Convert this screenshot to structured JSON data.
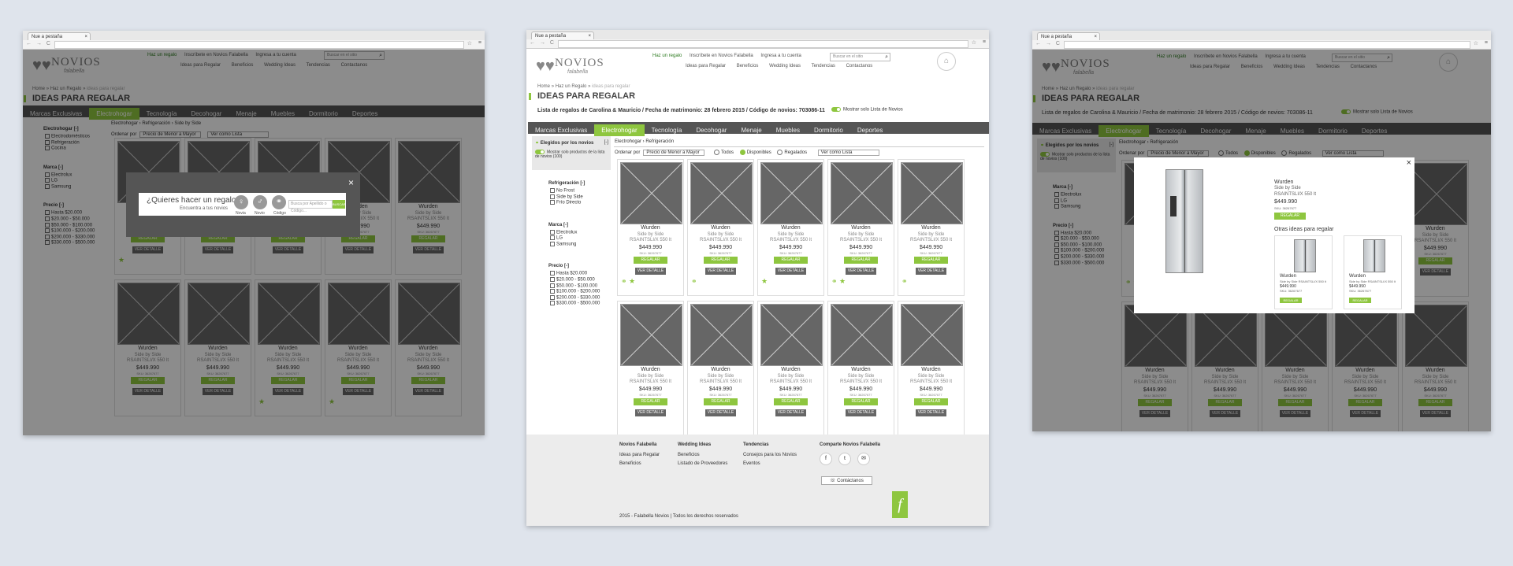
{
  "browser": {
    "tab_title": "Nue a pestaña",
    "tab_close": "×",
    "nav": "← → C",
    "url": "",
    "star": "☆",
    "menu": "≡"
  },
  "header": {
    "logo_name": "NOVIOS",
    "logo_sub": "falabella",
    "top_links": [
      "Haz un regalo",
      "Inscríbete en Novios Falabella",
      "Ingresa a tu cuenta"
    ],
    "search_placeholder": "Buscar en el sitio",
    "sub_links": [
      "Ideas para Regalar",
      "Beneficios",
      "Wedding Ideas",
      "Tendencias",
      "Contactanos"
    ]
  },
  "breadcrumb": {
    "home": "Home",
    "sep": "»",
    "mid": "Haz un Regalo",
    "last": "ideas para regalar"
  },
  "page_title": "IDEAS PARA REGALAR",
  "list_info": "Lista de regalos de Carolina & Mauricio / Fecha de matrimonio: 28 febrero 2015 / Código de novios: 703086-11",
  "toggle_label": "Mostrar solo Lista de Novios",
  "categories": [
    "Marcas Exclusivas",
    "Electrohogar",
    "Tecnología",
    "Decohogar",
    "Menaje",
    "Muebles",
    "Dormitorio",
    "Deportes"
  ],
  "category_crumb": "Electrohogar › Refrigeración",
  "category_crumb_w1": "Electrohogar › Refrigeración › Side by Side",
  "sort": {
    "label": "Ordenar por",
    "value": "Precio de Menor a Mayor",
    "view": "Ver como Lista",
    "radios": [
      "Todos",
      "Disponibles",
      "Regalados"
    ]
  },
  "elegidos": {
    "title": "Elegidos por los novios",
    "toggle": "Mostrar solo productos de la lista de novios (100)",
    "collapse": "[-]"
  },
  "filters_w1": [
    {
      "title": "Electrohogar [-]",
      "options": [
        "Electrodomésticos",
        "Refrigeración",
        "Cocina"
      ]
    },
    {
      "title": "Marca [-]",
      "options": [
        "Electrolux",
        "LG",
        "Samsung"
      ]
    },
    {
      "title": "Precio [-]",
      "options": [
        "Hasta $20.000",
        "$20.000 - $50.000",
        "$50.000 - $100.000",
        "$100.000 - $200.000",
        "$200.000 - $330.000",
        "$330.000 - $500.000"
      ]
    }
  ],
  "filters": [
    {
      "title": "Refrigeración [-]",
      "options": [
        "No Frost",
        "Side by Side",
        "Frío Directo"
      ]
    },
    {
      "title": "Marca [-]",
      "options": [
        "Electrolux",
        "LG",
        "Samsung"
      ]
    },
    {
      "title": "Precio [-]",
      "options": [
        "Hasta $20.000",
        "$20.000 - $50.000",
        "$50.000 - $100.000",
        "$100.000 - $200.000",
        "$200.000 - $330.000",
        "$330.000 - $500.000"
      ]
    }
  ],
  "product": {
    "brand": "Wurden",
    "line1": "Side by Side",
    "line2": "RSAINTSLI/X 550 lt",
    "price": "$449.990",
    "sku": "SKU: 36267677",
    "regalar": "REGALAR",
    "detalle": "VER DETALLE"
  },
  "row1_icons": [
    "⚭ ★",
    "⚭",
    "★",
    "⚭ ★",
    "⚭"
  ],
  "w1_row1_icons": [
    "★",
    "",
    "",
    "",
    ""
  ],
  "w1_row2_icons": [
    "",
    "",
    "★",
    "★",
    ""
  ],
  "footer": {
    "col1": {
      "title": "Novios Falabella",
      "links": [
        "Ideas para Regalar",
        "Beneficios"
      ]
    },
    "col2": {
      "title": "Wedding Ideas",
      "links": [
        "Beneficios",
        "Listado de Proveedores"
      ]
    },
    "col3": {
      "title": "Tendencias",
      "links": [
        "Consejos para los Novios",
        "Eventos"
      ]
    },
    "col4": {
      "title": "Comparte Novios Falabella",
      "contact": "Contáctanos",
      "social": [
        "f",
        "t",
        "✉"
      ]
    },
    "logo": "f",
    "copyright": "2015 - Falabella Novios | Todos los derechos reservados"
  },
  "modal1": {
    "question": "¿Quieres hacer un regalo?",
    "sub": "Encuentra a tus novios",
    "avatars": [
      "Novia",
      "Novio",
      "Código"
    ],
    "placeholder": "Busca por Apellido o Código...",
    "button": "BUSCAR",
    "close": "×"
  },
  "modal3": {
    "brand": "Wurden",
    "line1": "Side by Side",
    "line2": "RSAINTSLI/X 550 lt",
    "price": "$449.990",
    "sku": "SKU: 36267677",
    "regalar": "REGALAR",
    "others": "Otras ideas para regalar",
    "mini_brand": "Wurden",
    "mini_model": "Side by Side RSAINTSLI/X 550 lt",
    "mini_price": "$449.990",
    "mini_sku": "SKU: 36267677",
    "close": "×"
  },
  "colors": {
    "accent": "#8ec63f",
    "catbar": "#555555",
    "background": "#dfe4ec"
  }
}
